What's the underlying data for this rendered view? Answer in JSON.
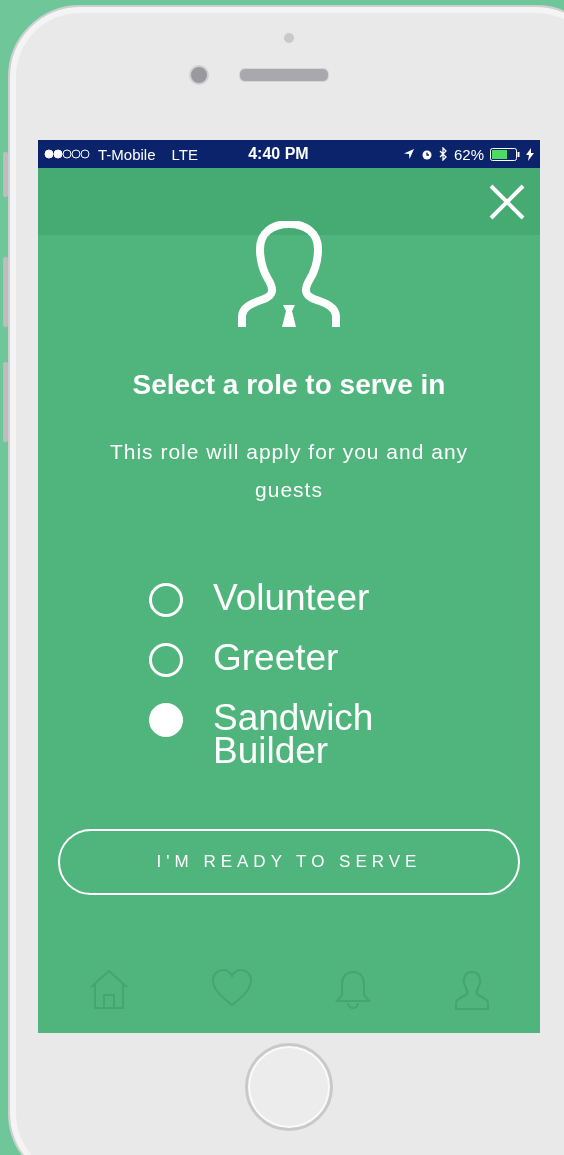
{
  "status_bar": {
    "carrier": "T-Mobile",
    "network": "LTE",
    "time": "4:40 PM",
    "battery": "62%"
  },
  "dialog": {
    "title": "Select a role to serve in",
    "subtitle": "This role will apply for you and any guests",
    "roles": [
      {
        "label": "Volunteer",
        "selected": false
      },
      {
        "label": "Greeter",
        "selected": false
      },
      {
        "label": "Sandwich Builder",
        "selected": true
      }
    ],
    "button": "I'M READY TO SERVE"
  }
}
